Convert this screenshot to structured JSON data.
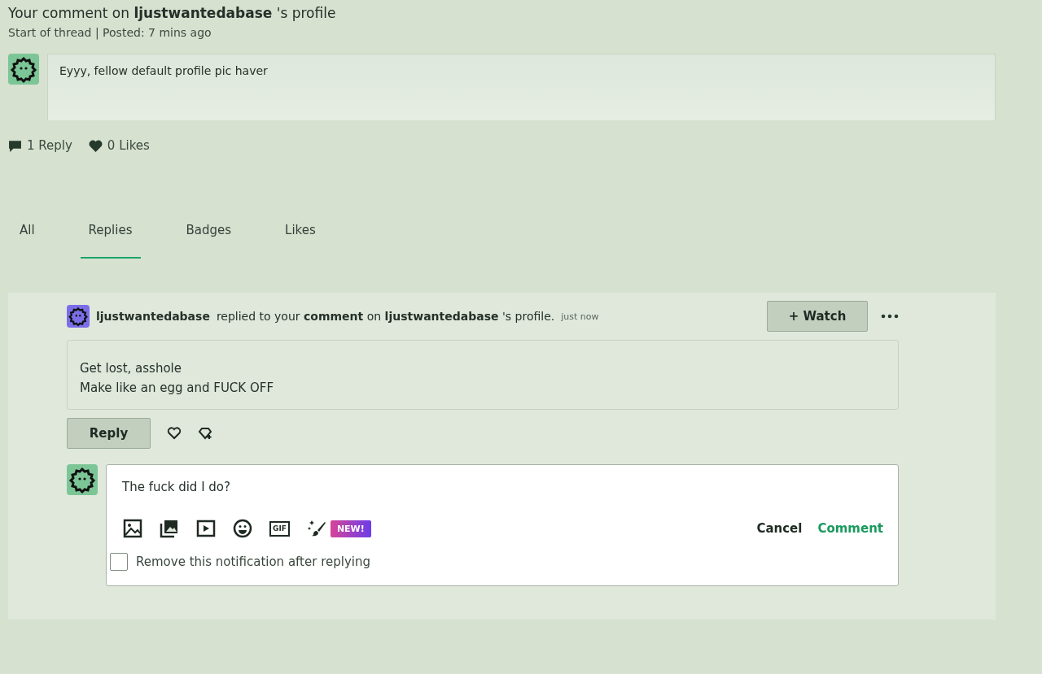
{
  "thread": {
    "title": "Your comment on **ljustwantedabase** 's profile",
    "meta": "Start of thread | Posted: 7 mins ago",
    "comment": "Eyyy, fellow default profile pic haver",
    "replies": "1 Reply",
    "likes": "0 Likes"
  },
  "tabs": [
    {
      "label": "All",
      "selected": false
    },
    {
      "label": "Replies",
      "selected": true
    },
    {
      "label": "Badges",
      "selected": false
    },
    {
      "label": "Likes",
      "selected": false
    }
  ],
  "notification": {
    "user": "ljustwantedabase",
    "action": "replied to your **comment** on **ljustwantedabase** 's profile.",
    "time": "just now",
    "watch": "+ Watch",
    "lines": [
      "Get lost, asshole",
      "Make like an egg and FUCK OFF"
    ],
    "reply": "Reply"
  },
  "composer": {
    "value": "The fuck did I do?",
    "gif": "GIF",
    "badge": "NEW!",
    "cancel": "Cancel",
    "submit": "Comment",
    "remove_checkbox": {
      "label": "Remove this notification after replying",
      "checked": false
    }
  }
}
